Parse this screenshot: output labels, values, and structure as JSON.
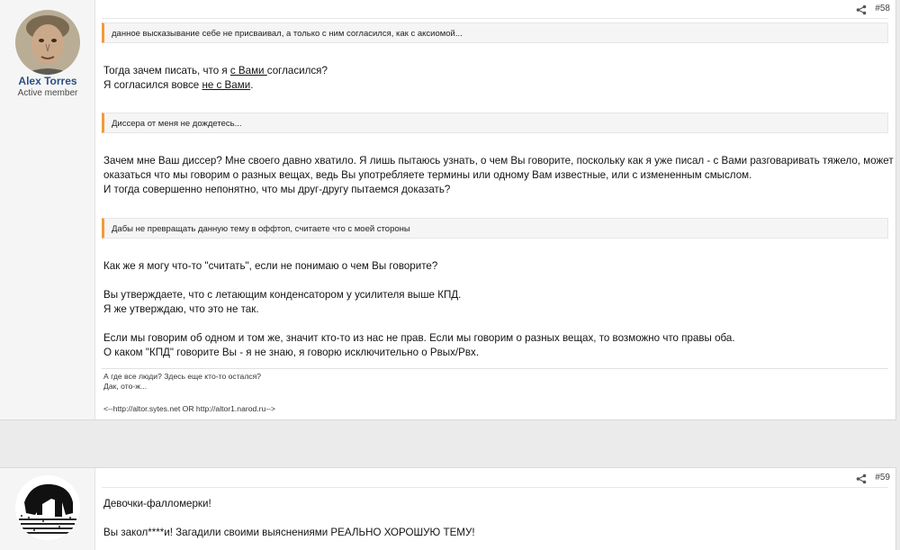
{
  "posts": [
    {
      "number": "#58",
      "username": "Alex Torres",
      "usertitle": "Active member",
      "quotes": [
        "данное высказывание себе не присваивал, а только с ним согласился, как с аксиомой...",
        "Диссера от меня не дождетесь...",
        "Дабы не превращать данную тему в оффтоп, считаете что с моей стороны"
      ],
      "reply1": {
        "l1a": "Тогда зачем писать, что я ",
        "l1b": "с Вами ",
        "l1c": "согласился?",
        "l2a": "Я согласился вовсе ",
        "l2b": "не с Вами",
        "l2c": "."
      },
      "reply2": [
        "Зачем мне Ваш диссер? Мне своего давно хватило. Я лишь пытаюсь узнать, о чем Вы говорите, поскольку как я уже писал - с Вами разговаривать тяжело, может",
        "оказаться что мы говорим о разных вещах, ведь Вы употребляете термины или одному Вам известные, или с измененным смыслом.",
        "И тогда совершенно непонятно, что мы друг-другу пытаемся доказать?"
      ],
      "reply3": [
        "Как же я могу что-то \"считать\", если не понимаю о чем Вы говорите?",
        "Вы утверждаете, что с летающим конденсатором у усилителя выше КПД.",
        "Я же утверждаю, что это не так.",
        "Если мы говорим об одном и том же, значит кто-то из нас не прав. Если мы говорим о разных вещах, то возможно что правы оба.",
        "О каком \"КПД\" говорите Вы - я не знаю, я говорю исключительно о Рвых/Рвх."
      ],
      "signature": [
        "А где все люди? Здесь еще кто-то остался?",
        "Дак, ото-ж...",
        "<--http://altor.sytes.net OR http://altor1.narod.ru-->"
      ]
    },
    {
      "number": "#59",
      "lines": [
        "Девочки-фалломерки!",
        "Вы закол****и! Загадили своими выяснениями РЕАЛЬНО ХОРОШУЮ ТЕМУ!"
      ]
    }
  ],
  "icons": {
    "share": "share-icon"
  },
  "colors": {
    "quote_accent": "#f09a3b",
    "username": "#2b4f86"
  }
}
